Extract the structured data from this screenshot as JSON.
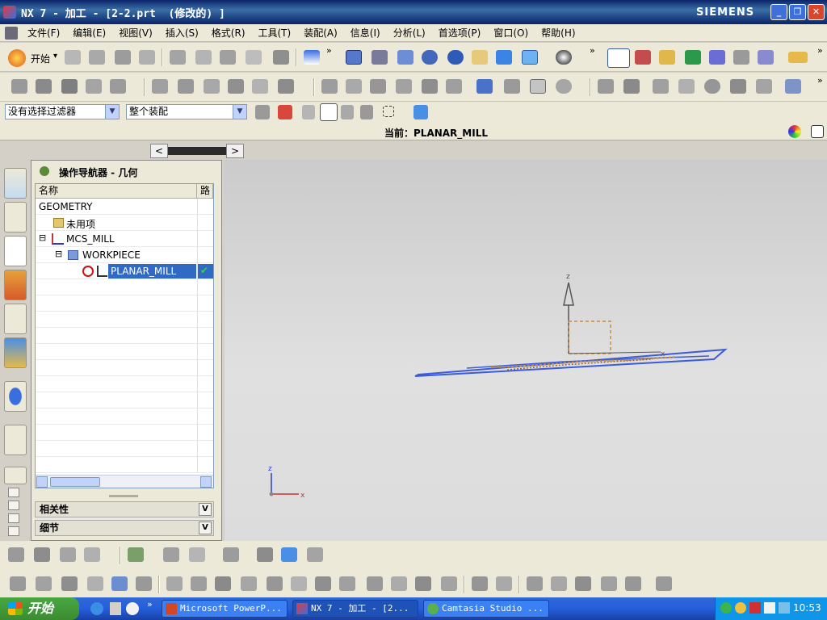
{
  "window": {
    "title": "NX 7 - 加工 - [2-2.prt  (修改的) ]",
    "brand": "SIEMENS",
    "controls": [
      "_",
      "❐",
      "✕"
    ]
  },
  "menubar": {
    "items": [
      "文件(F)",
      "编辑(E)",
      "视图(V)",
      "插入(S)",
      "格式(R)",
      "工具(T)",
      "装配(A)",
      "信息(I)",
      "分析(L)",
      "首选项(P)",
      "窗口(O)",
      "帮助(H)"
    ]
  },
  "toolbar": {
    "start_label": "开始",
    "start_arrow": "▾",
    "more_glyph": "»"
  },
  "filter": {
    "selection_filter": "没有选择过滤器",
    "scope": "整个装配",
    "dropdown_glyph": "▼"
  },
  "status": {
    "current_label": "当前：PLANAR_MILL"
  },
  "navigator": {
    "title": "操作导航器 - 几何",
    "prev_glyph": "<",
    "next_glyph": ">",
    "columns": [
      "名称",
      "路"
    ],
    "rows": [
      {
        "label": "GEOMETRY",
        "level": 0,
        "expander": ""
      },
      {
        "label": "未用项",
        "level": 1,
        "expander": ""
      },
      {
        "label": "MCS_MILL",
        "level": 1,
        "expander": "⊟"
      },
      {
        "label": "WORKPIECE",
        "level": 2,
        "expander": "⊟"
      },
      {
        "label": "PLANAR_MILL",
        "level": 3,
        "expander": "",
        "selected": true,
        "status": "✔"
      }
    ],
    "sections": [
      {
        "label": "相关性",
        "chevron": "V"
      },
      {
        "label": "细节",
        "chevron": "V"
      }
    ]
  },
  "viewport": {
    "axis_labels": {
      "x": "x",
      "y": "y",
      "z": "z"
    }
  },
  "taskbar": {
    "start_label": "开始",
    "more_glyph": "»",
    "tasks": [
      {
        "label": "Microsoft PowerP...",
        "active": false
      },
      {
        "label": "NX 7 - 加工 - [2...",
        "active": true
      },
      {
        "label": "Camtasia Studio ...",
        "active": false
      }
    ],
    "clock": "10:53"
  },
  "colors": {
    "title_bar": "#0a246a",
    "selection": "#316ac5",
    "taskbar": "#245edb",
    "start": "#3c8b31",
    "geometry_blue": "#3b5bd9",
    "toolpath_orange": "#c98b3c"
  },
  "icons": [
    "open-icon",
    "save-icon",
    "cut-icon",
    "copy-icon",
    "paste-icon",
    "delete-icon",
    "undo-icon",
    "fit-view-icon",
    "zoom-icon",
    "rotate-icon",
    "shaded-view-icon",
    "wcs-icon",
    "create-operation-icon",
    "generate-toolpath-icon",
    "verify-toolpath-icon",
    "info-icon",
    "web-browser-icon",
    "measure-icon"
  ]
}
